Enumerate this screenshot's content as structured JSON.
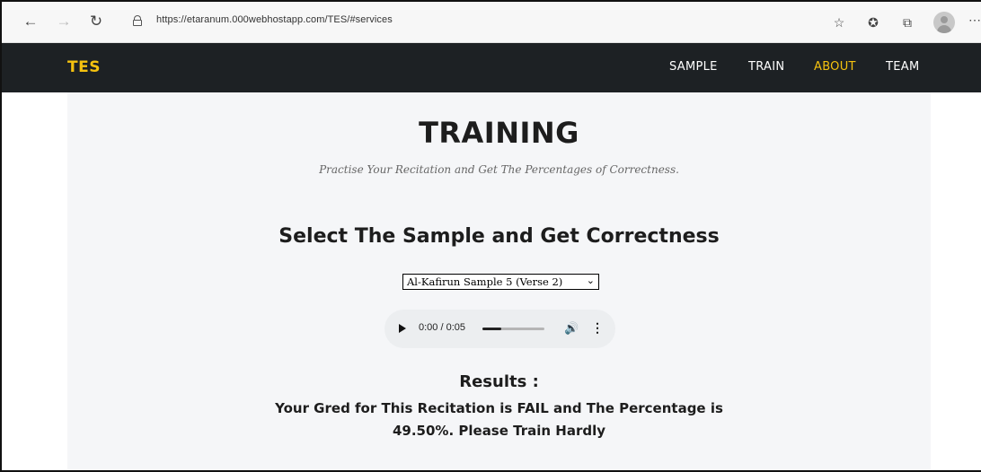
{
  "browser": {
    "url": "https://etaranum.000webhostapp.com/TES/#services",
    "icons": [
      "back-arrow-icon",
      "forward-arrow-icon",
      "refresh-icon",
      "lock-icon",
      "read-aloud-icon",
      "favorites-icon",
      "collections-icon",
      "profile-icon",
      "more-icon"
    ]
  },
  "nav": {
    "brand": "TES",
    "links": [
      "SAMPLE",
      "TRAIN",
      "ABOUT",
      "TEAM"
    ],
    "active_link": "ABOUT",
    "brand_color": "#f5c20f"
  },
  "page": {
    "title": "TRAINING",
    "subtitle": "Practise Your Recitation and Get The Percentages of Correctness.",
    "section_heading": "Select The Sample and Get Correctness",
    "sample_select": {
      "selected": "Al-Kafirun Sample 5 (Verse 2)"
    },
    "audio": {
      "time": "0:00 / 0:05",
      "progress": 0.3
    },
    "results_label": "Results :",
    "results_text": "Your Gred for This Recitation is FAIL and The Percentage is 49.50%. Please Train Hardly"
  }
}
